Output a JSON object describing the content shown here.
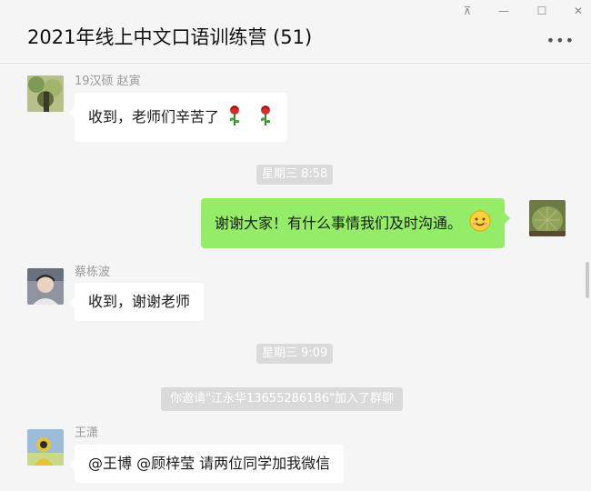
{
  "window": {
    "title": "2021年线上中文口语训练营 (51)",
    "more": "•••",
    "controls": {
      "pin": "⊼",
      "minimize": "—",
      "maximize": "☐",
      "close": "✕"
    }
  },
  "messages": [
    {
      "sender": "19汉硕 赵寅",
      "text": "收到，老师们辛苦了",
      "emoji": [
        "rose-icon",
        "rose-icon"
      ]
    },
    {
      "time": "星期三 8:58"
    },
    {
      "text": "谢谢大家！有什么事情我们及时沟通。",
      "emoji": [
        "smile-emoji-icon"
      ],
      "mine": true
    },
    {
      "sender": "蔡栋波",
      "text": "收到，谢谢老师"
    },
    {
      "time": "星期三 9:09"
    },
    {
      "system": "你邀请\"江永华13655286186\"加入了群聊"
    },
    {
      "sender": "王潇",
      "text": "@王博 @顾梓莹 请两位同学加我微信"
    }
  ],
  "colors": {
    "mine_bubble": "#95ec69",
    "other_bubble": "#ffffff",
    "background": "#f5f5f5",
    "time_badge": "#dadada"
  }
}
